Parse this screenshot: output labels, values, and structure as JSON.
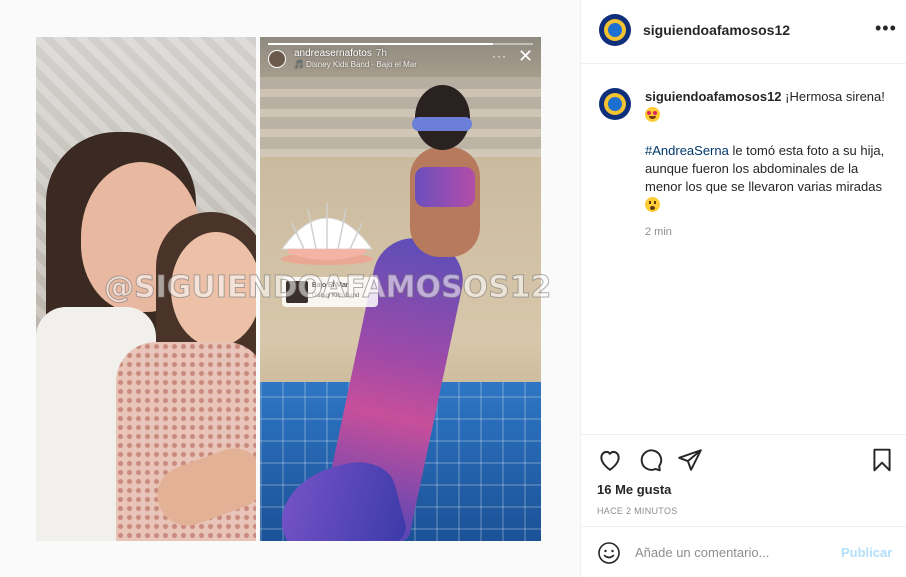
{
  "post": {
    "username": "siguiendoafamosos12",
    "more_icon": "more-horizontal-icon",
    "caption": {
      "username": "siguiendoafamosos12",
      "line1": "¡Hermosa sirena!",
      "hashtag": "#AndreaSerna",
      "line2": " le tomó esta foto a su hija, aunque fueron los abdominales de la menor los que se llevaron varias miradas",
      "time": "2 min"
    },
    "likes": "16 Me gusta",
    "posted_ago": "HACE 2 MINUTOS",
    "comment_placeholder": "Añade un comentario...",
    "publish_label": "Publicar"
  },
  "media": {
    "watermark": "@SIGUIENDOAFAMOSOS12",
    "story": {
      "user": "andreasernafotos",
      "time": "7h",
      "song": "🎵 Disney Kids Band · Bajo el Mar",
      "more": "···",
      "close": "✕",
      "progress": 0.85,
      "music_title": "Bajo El Mar",
      "music_artist": "Disney Kids Band"
    }
  },
  "colors": {
    "link": "#00376b",
    "publish_disabled": "#b2dffc",
    "muted": "#8e8e8e"
  }
}
